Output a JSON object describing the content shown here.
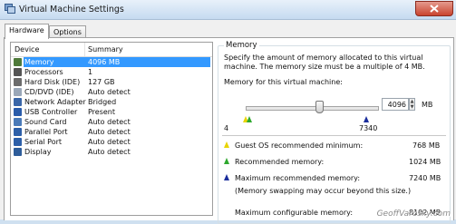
{
  "window": {
    "title": "Virtual Machine Settings"
  },
  "tabs": [
    {
      "label": "Hardware"
    },
    {
      "label": "Options"
    }
  ],
  "device_list": {
    "headers": {
      "device": "Device",
      "summary": "Summary"
    },
    "rows": [
      {
        "name": "Memory",
        "summary": "4096 MB",
        "icon": "memory-icon"
      },
      {
        "name": "Processors",
        "summary": "1",
        "icon": "processor-icon"
      },
      {
        "name": "Hard Disk (IDE)",
        "summary": "127 GB",
        "icon": "hard-disk-icon"
      },
      {
        "name": "CD/DVD (IDE)",
        "summary": "Auto detect",
        "icon": "cd-dvd-icon"
      },
      {
        "name": "Network Adapter",
        "summary": "Bridged",
        "icon": "network-adapter-icon"
      },
      {
        "name": "USB Controller",
        "summary": "Present",
        "icon": "usb-controller-icon"
      },
      {
        "name": "Sound Card",
        "summary": "Auto detect",
        "icon": "sound-card-icon"
      },
      {
        "name": "Parallel Port",
        "summary": "Auto detect",
        "icon": "parallel-port-icon"
      },
      {
        "name": "Serial Port",
        "summary": "Auto detect",
        "icon": "serial-port-icon"
      },
      {
        "name": "Display",
        "summary": "Auto detect",
        "icon": "display-icon"
      }
    ]
  },
  "memory_panel": {
    "legend": "Memory",
    "description_line1": "Specify the amount of memory allocated to this virtual",
    "description_line2": "machine. The memory size must be a multiple of 4 MB.",
    "slider_label": "Memory for this virtual machine:",
    "value": "4096",
    "unit": "MB",
    "slider_min_label": "4",
    "slider_max_label": "7340",
    "slider_level_fraction": 0.56,
    "rows": [
      {
        "label": "Guest OS recommended minimum:",
        "value": "768 MB",
        "icon": "yellow-triangle-icon",
        "color": "#e8d400"
      },
      {
        "label": "Recommended memory:",
        "value": "1024 MB",
        "icon": "green-triangle-icon",
        "color": "#2ea82e"
      },
      {
        "label": "Maximum recommended memory:",
        "value": "7240 MB",
        "icon": "blue-triangle-icon",
        "color": "#1b2e9c"
      }
    ],
    "note": "(Memory swapping may occur beyond this size.)",
    "max_configurable_label": "Maximum configurable memory:",
    "max_configurable_value": "8192 MB"
  },
  "watermark": "GeoffVarosky.com",
  "colors": {
    "selection": "#3399ff",
    "titlebar": "#c5daf0",
    "close": "#c9442f"
  }
}
